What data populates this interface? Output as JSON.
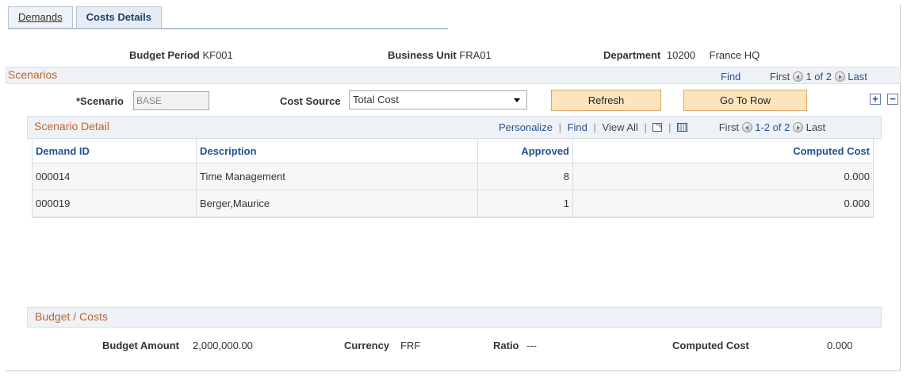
{
  "tabs": [
    {
      "label": "Demands",
      "active": false
    },
    {
      "label": "Costs Details",
      "active": true
    }
  ],
  "header": {
    "budget_period_label": "Budget Period",
    "budget_period_value": "KF001",
    "business_unit_label": "Business Unit",
    "business_unit_value": "FRA01",
    "department_label": "Department",
    "department_value": "10200",
    "department_name": "France HQ"
  },
  "scenarios": {
    "title": "Scenarios",
    "find": "Find",
    "first": "First",
    "range": "1 of 2",
    "last": "Last",
    "scenario_label": "*Scenario",
    "scenario_value": "BASE",
    "cost_source_label": "Cost Source",
    "cost_source_value": "Total Cost",
    "refresh_label": "Refresh",
    "goto_label": "Go To Row",
    "add_symbol": "+",
    "remove_symbol": "−"
  },
  "scenario_detail": {
    "title": "Scenario Detail",
    "personalize": "Personalize",
    "find": "Find",
    "view_all": "View All",
    "sep": "|",
    "first": "First",
    "range": "1-2 of 2",
    "last": "Last",
    "columns": [
      "Demand ID",
      "Description",
      "Approved",
      "Computed Cost"
    ],
    "rows": [
      [
        "000014",
        "Time Management",
        "8",
        "0.000"
      ],
      [
        "000019",
        "Berger,Maurice",
        "1",
        "0.000"
      ]
    ]
  },
  "budget": {
    "title": "Budget / Costs",
    "budget_amount_label": "Budget Amount",
    "budget_amount_value": "2,000,000.00",
    "currency_label": "Currency",
    "currency_value": "FRF",
    "ratio_label": "Ratio",
    "ratio_value": "---",
    "computed_cost_label": "Computed Cost",
    "computed_cost_value": "0.000"
  }
}
